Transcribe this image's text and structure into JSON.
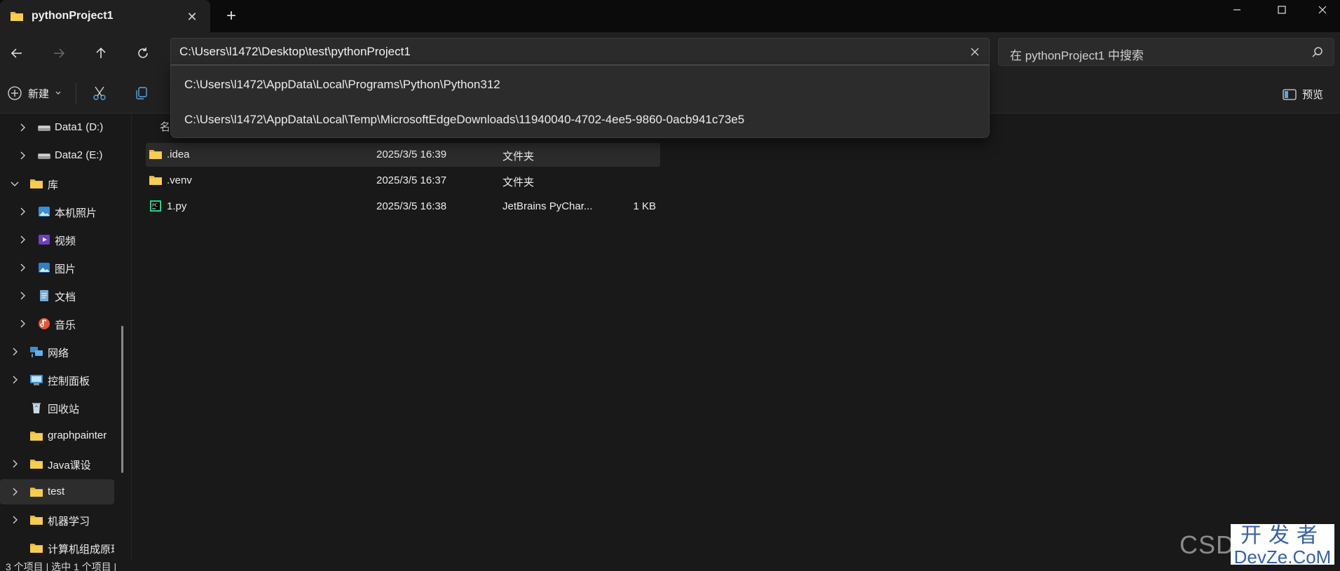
{
  "tab": {
    "title": "pythonProject1",
    "folder_icon": "folder-icon",
    "close": "✕",
    "new_tab": "+"
  },
  "window": {
    "minimize": "—",
    "maximize": "☐",
    "close": "✕"
  },
  "address_bar": {
    "value": "C:\\Users\\l1472\\Desktop\\test\\pythonProject1",
    "suggestions": [
      "C:\\Users\\l1472\\AppData\\Local\\Programs\\Python\\Python312",
      "C:\\Users\\l1472\\AppData\\Local\\Temp\\MicrosoftEdgeDownloads\\11940040-4702-4ee5-9860-0acb941c73e5"
    ]
  },
  "search": {
    "placeholder": "在 pythonProject1 中搜索"
  },
  "commands": {
    "new_label": "新建",
    "preview_label": "预览"
  },
  "sidebar": {
    "items": [
      {
        "label": "Data1 (D:)",
        "icon": "drive-icon"
      },
      {
        "label": "Data2 (E:)",
        "icon": "drive-icon"
      },
      {
        "label": "库",
        "icon": "folder-icon"
      },
      {
        "label": "本机照片",
        "icon": "photos-icon"
      },
      {
        "label": "视频",
        "icon": "video-icon"
      },
      {
        "label": "图片",
        "icon": "pictures-icon"
      },
      {
        "label": "文档",
        "icon": "documents-icon"
      },
      {
        "label": "音乐",
        "icon": "music-icon"
      },
      {
        "label": "网络",
        "icon": "network-icon"
      },
      {
        "label": "控制面板",
        "icon": "control-panel-icon"
      },
      {
        "label": "回收站",
        "icon": "recycle-bin-icon"
      },
      {
        "label": "graphpainter",
        "icon": "folder-icon"
      },
      {
        "label": "Java课设",
        "icon": "folder-icon"
      },
      {
        "label": "test",
        "icon": "folder-icon"
      },
      {
        "label": "机器学习",
        "icon": "folder-icon"
      },
      {
        "label": "计算机组成原理",
        "icon": "folder-icon"
      }
    ]
  },
  "file_list": {
    "column_name_partial": "名",
    "rows": [
      {
        "name": ".idea",
        "date": "2025/3/5 16:39",
        "type": "文件夹",
        "size": "",
        "icon": "folder-icon"
      },
      {
        "name": ".venv",
        "date": "2025/3/5 16:37",
        "type": "文件夹",
        "size": "",
        "icon": "folder-icon"
      },
      {
        "name": "1.py",
        "date": "2025/3/5 16:38",
        "type": "JetBrains PyChar...",
        "size": "1 KB",
        "icon": "pycharm-file-icon"
      }
    ]
  },
  "status": {
    "text": "3 个项目  |  选中 1 个项目  |"
  },
  "watermark": {
    "left": "CSD",
    "top": "开发者",
    "bottom": "DevZe.CoM"
  },
  "colors": {
    "background": "#191919",
    "titlebar": "#0b0b0b",
    "folder": "#f4c542",
    "accent": "#4aa3df"
  }
}
